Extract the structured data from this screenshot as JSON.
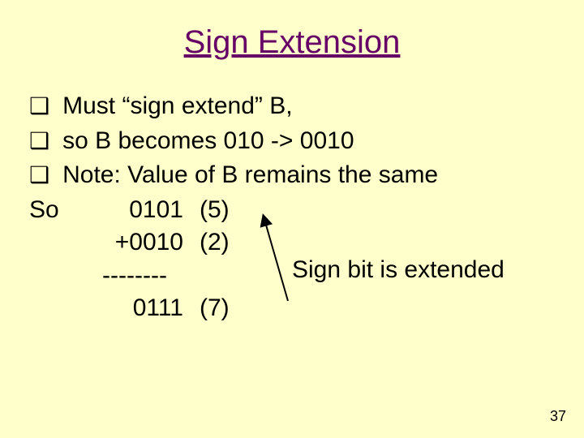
{
  "title": "Sign Extension",
  "bullets": {
    "b1": "Must “sign extend” B,",
    "b2": "so B becomes 010 -> 0010",
    "b3": "Note: Value of B remains the same"
  },
  "so": {
    "label": "So",
    "r1_bin": "0101",
    "r1_dec": "(5)",
    "r2_bin": "+0010",
    "r2_dec": "(2)",
    "rule": "--------",
    "r3_bin": "0111",
    "r3_dec": "(7)"
  },
  "annotation": "Sign bit is extended",
  "page": "37"
}
